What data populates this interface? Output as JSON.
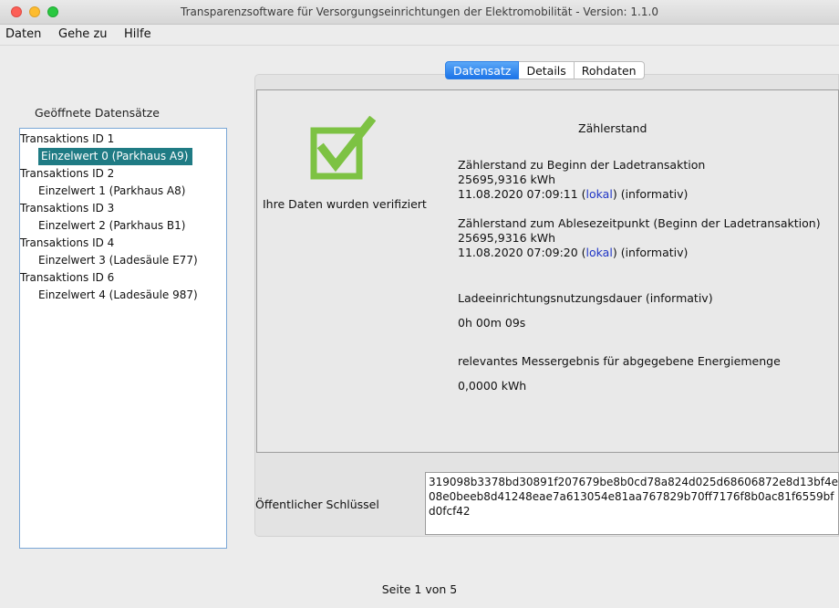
{
  "window": {
    "title": "Transparenzsoftware für Versorgungseinrichtungen der Elektromobilität - Version: 1.1.0"
  },
  "menu": [
    "Daten",
    "Gehe zu",
    "Hilfe"
  ],
  "sidebar": {
    "title": "Geöffnete Datensätze",
    "items": [
      {
        "label": "Transaktions ID 1",
        "level": 0
      },
      {
        "label": "Einzelwert 0 (Parkhaus A9)",
        "level": 1,
        "selected": true
      },
      {
        "label": "Transaktions ID 2",
        "level": 0
      },
      {
        "label": "Einzelwert 1 (Parkhaus A8)",
        "level": 1
      },
      {
        "label": "Transaktions ID 3",
        "level": 0
      },
      {
        "label": "Einzelwert 2 (Parkhaus B1)",
        "level": 1
      },
      {
        "label": "Transaktions ID 4",
        "level": 0
      },
      {
        "label": "Einzelwert 3 (Ladesäule E77)",
        "level": 1
      },
      {
        "label": "Transaktions ID 6",
        "level": 0
      },
      {
        "label": "Einzelwert 4 (Ladesäule 987)",
        "level": 1
      }
    ]
  },
  "tabs": [
    {
      "label": "Datensatz",
      "active": true
    },
    {
      "label": "Details"
    },
    {
      "label": "Rohdaten"
    }
  ],
  "verification": {
    "icon": "check-icon",
    "text": "Ihre Daten wurden verifiziert",
    "color": "#7dc243"
  },
  "details": {
    "heading": "Zählerstand",
    "start": {
      "label": "Zählerstand zu Beginn der Ladetransaktion",
      "value": "25695,9316 kWh",
      "timestamp": "11.08.2020 07:09:11",
      "lokal": "lokal",
      "note": "(informativ)"
    },
    "reading": {
      "label": "Zählerstand zum Ablesezeitpunkt (Beginn der Ladetransaktion)",
      "value": "25695,9316 kWh",
      "timestamp": "11.08.2020 07:09:20",
      "lokal": "lokal",
      "note": "(informativ)"
    },
    "duration": {
      "label": "Ladeeinrichtungsnutzungsdauer (informativ)",
      "value": "0h 00m 09s"
    },
    "result": {
      "label": "relevantes Messergebnis für abgegebene Energiemenge",
      "value": "0,0000 kWh"
    }
  },
  "public_key": {
    "label": "Öffentlicher Schlüssel",
    "value": "319098b3378bd30891f207679be8b0cd78a824d025d68606872e8d13bf4e08e0beeb8d41248eae7a613054e81aa767829b70ff7176f8b0ac81f6559bfd0fcf42"
  },
  "pager": {
    "text": "Seite 1 von 5"
  }
}
